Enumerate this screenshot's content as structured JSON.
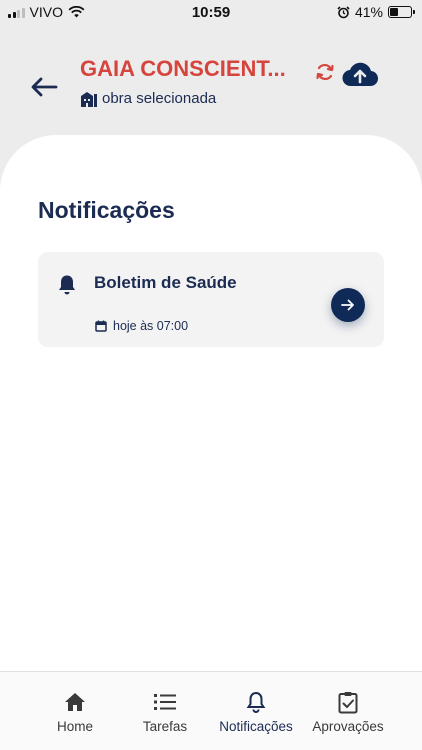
{
  "status_bar": {
    "carrier": "VIVO",
    "time": "10:59",
    "battery": "41%",
    "battery_level": 0.41
  },
  "header": {
    "title": "GAIA CONSCIENT...",
    "subtitle": "obra selecionada",
    "accent_color": "#d6453d",
    "primary_color": "#1b2b52"
  },
  "main": {
    "section_title": "Notificações",
    "notifications": [
      {
        "title": "Boletim de Saúde",
        "date": "hoje às 07:00"
      }
    ]
  },
  "nav": {
    "items": [
      {
        "label": "Home",
        "icon": "home-icon"
      },
      {
        "label": "Tarefas",
        "icon": "list-icon"
      },
      {
        "label": "Notificações",
        "icon": "bell-icon",
        "active": true
      },
      {
        "label": "Aprovações",
        "icon": "clipboard-check-icon"
      }
    ]
  }
}
